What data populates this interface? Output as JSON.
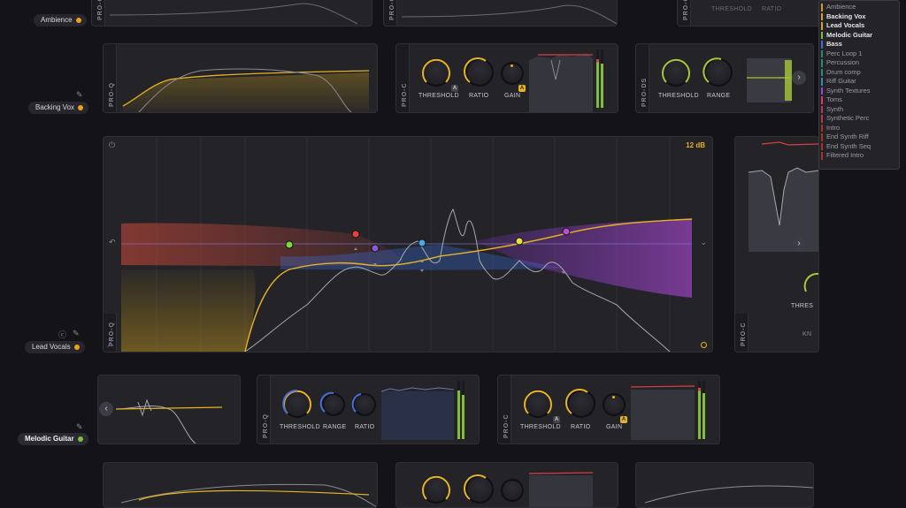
{
  "tracks": {
    "ambience": {
      "label": "Ambience",
      "dot": "#e8a31e"
    },
    "backing_vox": {
      "label": "Backing Vox",
      "dot": "#e8a31e"
    },
    "lead_vocals": {
      "label": "Lead Vocals",
      "dot": "#e8a31e"
    },
    "melodic_guitar": {
      "label": "Melodic Guitar",
      "dot": "#7fbf3a"
    }
  },
  "plugins": {
    "pro_q": "PRO-Q",
    "pro_c": "PRO-C",
    "pro_ds": "PRO-DS"
  },
  "top_row": {
    "threshold": "THRESHOLD",
    "ratio": "RATIO"
  },
  "backing_vox_comp": {
    "threshold": "THRESHOLD",
    "ratio": "RATIO",
    "gain": "GAIN",
    "auto": "A"
  },
  "backing_vox_ds": {
    "threshold": "THRESHOLD",
    "range": "RANGE"
  },
  "lead_vocals_eq": {
    "range_label": "12 dB"
  },
  "lead_vocals_comp": {
    "threshold_partial": "THRES",
    "knee_partial": "KN"
  },
  "melodic_guitar_gate": {
    "threshold": "THRESHOLD",
    "range": "RANGE",
    "ratio": "RATIO"
  },
  "melodic_guitar_comp": {
    "threshold": "THRESHOLD",
    "ratio": "RATIO",
    "gain": "GAIN",
    "auto": "A"
  },
  "track_menu": {
    "items": [
      {
        "label": "Ambience",
        "color": "#d49a2a",
        "highlight": false
      },
      {
        "label": "Backing Vox",
        "color": "#d4a32a",
        "highlight": true
      },
      {
        "label": "Lead Vocals",
        "color": "#d4a32a",
        "highlight": true
      },
      {
        "label": "Melodic Guitar",
        "color": "#7fbf3a",
        "highlight": true
      },
      {
        "label": "Bass",
        "color": "#3a6ed4",
        "highlight": true
      },
      {
        "label": "Perc Loop 1",
        "color": "#2a8a6a",
        "highlight": false
      },
      {
        "label": "Percussion",
        "color": "#2a8a6a",
        "highlight": false
      },
      {
        "label": "Drum comp",
        "color": "#2a8a8a",
        "highlight": false
      },
      {
        "label": "Riff Guitar",
        "color": "#3a8aa4",
        "highlight": false
      },
      {
        "label": "Synth Textures",
        "color": "#8a4ad4",
        "highlight": false
      },
      {
        "label": "Toms",
        "color": "#d43a6a",
        "highlight": false
      },
      {
        "label": "Synth",
        "color": "#b43a5a",
        "highlight": false
      },
      {
        "label": "Synthetic Perc",
        "color": "#b43a4a",
        "highlight": false
      },
      {
        "label": "Intro",
        "color": "#a4342a",
        "highlight": false
      },
      {
        "label": "End Synth Riff",
        "color": "#a4342a",
        "highlight": false
      },
      {
        "label": "End Synth Seq",
        "color": "#a4342a",
        "highlight": false
      },
      {
        "label": "Filtered Intro",
        "color": "#a4342a",
        "highlight": false
      }
    ]
  },
  "colors": {
    "accent_yellow": "#e8b321",
    "accent_purple": "#b04ad8",
    "accent_red": "#d84040",
    "accent_blue": "#4a90d8",
    "accent_green": "#7fd83a"
  }
}
